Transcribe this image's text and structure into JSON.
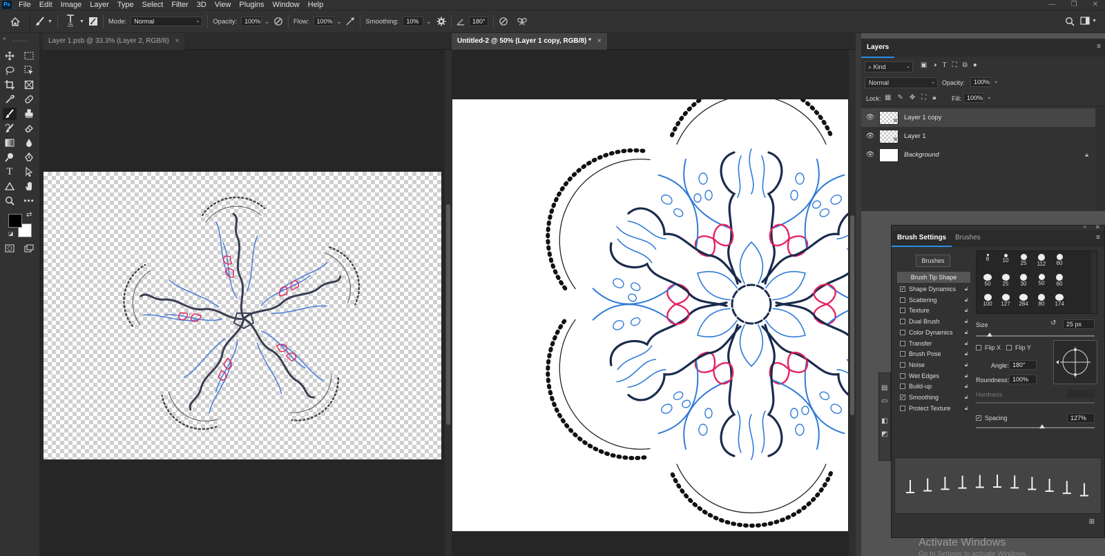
{
  "app": {
    "logo": "Ps"
  },
  "menu": [
    "File",
    "Edit",
    "Image",
    "Layer",
    "Type",
    "Select",
    "Filter",
    "3D",
    "View",
    "Plugins",
    "Window",
    "Help"
  ],
  "options": {
    "brush_size": "25",
    "mode_label": "Mode:",
    "mode_value": "Normal",
    "opacity_label": "Opacity:",
    "opacity_value": "100%",
    "flow_label": "Flow:",
    "flow_value": "100%",
    "smoothing_label": "Smoothing:",
    "smoothing_value": "10%",
    "angle_value": "180°"
  },
  "documents": [
    {
      "title": "Layer 1.psb @ 33.3% (Layer 2, RGB/8)",
      "active": false
    },
    {
      "title": "Untitled-2 @ 50% (Layer 1 copy, RGB/8) *",
      "active": true
    }
  ],
  "layers_panel": {
    "tab": "Layers",
    "filter_kind": "Kind",
    "blend_mode": "Normal",
    "opacity_label": "Opacity:",
    "opacity_value": "100%",
    "lock_label": "Lock:",
    "fill_label": "Fill:",
    "fill_value": "100%",
    "layers": [
      {
        "name": "Layer 1 copy",
        "selected": true
      },
      {
        "name": "Layer 1",
        "selected": false
      },
      {
        "name": "Background",
        "selected": false
      }
    ]
  },
  "brush_settings": {
    "tabs": [
      "Brush Settings",
      "Brushes"
    ],
    "brushes_button": "Brushes",
    "brush_tip_shape": "Brush Tip Shape",
    "options": [
      {
        "name": "Shape Dynamics",
        "checked": true
      },
      {
        "name": "Scattering",
        "checked": false
      },
      {
        "name": "Texture",
        "checked": false
      },
      {
        "name": "Dual Brush",
        "checked": false
      },
      {
        "name": "Color Dynamics",
        "checked": false
      },
      {
        "name": "Transfer",
        "checked": false
      },
      {
        "name": "Brush Pose",
        "checked": false
      },
      {
        "name": "Noise",
        "checked": false
      },
      {
        "name": "Wet Edges",
        "checked": false
      },
      {
        "name": "Build-up",
        "checked": false
      },
      {
        "name": "Smoothing",
        "checked": true
      },
      {
        "name": "Protect Texture",
        "checked": false
      }
    ],
    "tip_sizes": [
      "8",
      "10",
      "25",
      "112",
      "60",
      "50",
      "25",
      "30",
      "50",
      "60",
      "100",
      "127",
      "284",
      "80",
      "174"
    ],
    "size_label": "Size",
    "size_value": "25 px",
    "flip_x": "Flip X",
    "flip_y": "Flip Y",
    "angle_label": "Angle:",
    "angle_value": "180°",
    "roundness_label": "Roundness:",
    "roundness_value": "100%",
    "hardness_label": "Hardness",
    "spacing_label": "Spacing",
    "spacing_value": "127%"
  },
  "watermark": {
    "line1": "Activate Windows",
    "line2": "Go to Settings to activate Windows."
  }
}
